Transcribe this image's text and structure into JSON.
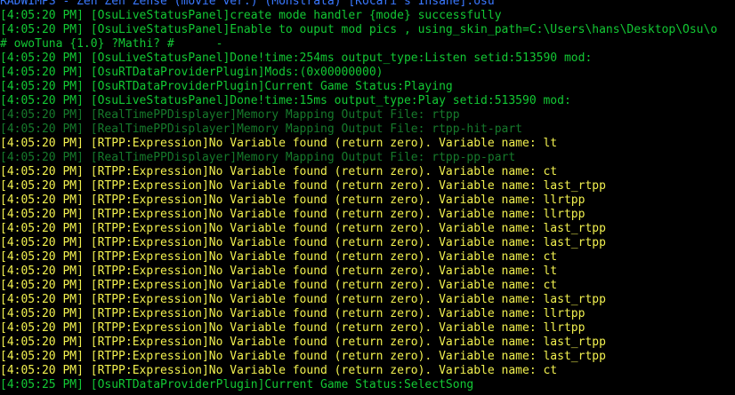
{
  "colors": {
    "background": "#000000",
    "blue": "#3a78ff",
    "green": "#13c934",
    "yellow": "#f2f14f",
    "dim_green": "#167a2b"
  },
  "console": {
    "lines": [
      {
        "color": "blue",
        "time": "",
        "text": "RADWIMPS - Zen Zen Zense (movie ver.) (Monstrata) [Kocari's Insane].osu"
      },
      {
        "color": "green",
        "time": "[4:05:20 PM] ",
        "text": "[OsuLiveStatusPanel]create mode handler {mode} successfully"
      },
      {
        "color": "green",
        "time": "[4:05:20 PM] ",
        "text": "[OsuLiveStatusPanel]Enable to ouput mod pics , using_skin_path=C:\\Users\\hans\\Desktop\\Osu\\o"
      },
      {
        "color": "green",
        "time": "",
        "text": "# owoTuna {1.0} ?Mathi? #      -"
      },
      {
        "color": "green",
        "time": "[4:05:20 PM] ",
        "text": "[OsuLiveStatusPanel]Done!time:254ms output_type:Listen setid:513590 mod:"
      },
      {
        "color": "green",
        "time": "[4:05:20 PM] ",
        "text": "[OsuRTDataProviderPlugin]Mods:(0x00000000)"
      },
      {
        "color": "green",
        "time": "[4:05:20 PM] ",
        "text": "[OsuRTDataProviderPlugin]Current Game Status:Playing"
      },
      {
        "color": "green",
        "time": "[4:05:20 PM] ",
        "text": "[OsuLiveStatusPanel]Done!time:15ms output_type:Play setid:513590 mod:"
      },
      {
        "color": "dim",
        "time": "[4:05:20 PM] ",
        "text": "[RealTimePPDisplayer]Memory Mapping Output File: rtpp"
      },
      {
        "color": "dim",
        "time": "[4:05:20 PM] ",
        "text": "[RealTimePPDisplayer]Memory Mapping Output File: rtpp-hit-part"
      },
      {
        "color": "yellow",
        "time": "[4:05:20 PM] ",
        "text": "[RTPP:Expression]No Variable found (return zero). Variable name: lt"
      },
      {
        "color": "dim",
        "time": "[4:05:20 PM] ",
        "text": "[RealTimePPDisplayer]Memory Mapping Output File: rtpp-pp-part"
      },
      {
        "color": "yellow",
        "time": "[4:05:20 PM] ",
        "text": "[RTPP:Expression]No Variable found (return zero). Variable name: ct"
      },
      {
        "color": "yellow",
        "time": "[4:05:20 PM] ",
        "text": "[RTPP:Expression]No Variable found (return zero). Variable name: last_rtpp"
      },
      {
        "color": "yellow",
        "time": "[4:05:20 PM] ",
        "text": "[RTPP:Expression]No Variable found (return zero). Variable name: llrtpp"
      },
      {
        "color": "yellow",
        "time": "[4:05:20 PM] ",
        "text": "[RTPP:Expression]No Variable found (return zero). Variable name: llrtpp"
      },
      {
        "color": "yellow",
        "time": "[4:05:20 PM] ",
        "text": "[RTPP:Expression]No Variable found (return zero). Variable name: last_rtpp"
      },
      {
        "color": "yellow",
        "time": "[4:05:20 PM] ",
        "text": "[RTPP:Expression]No Variable found (return zero). Variable name: last_rtpp"
      },
      {
        "color": "yellow",
        "time": "[4:05:20 PM] ",
        "text": "[RTPP:Expression]No Variable found (return zero). Variable name: ct"
      },
      {
        "color": "yellow",
        "time": "[4:05:20 PM] ",
        "text": "[RTPP:Expression]No Variable found (return zero). Variable name: lt"
      },
      {
        "color": "yellow",
        "time": "[4:05:20 PM] ",
        "text": "[RTPP:Expression]No Variable found (return zero). Variable name: ct"
      },
      {
        "color": "yellow",
        "time": "[4:05:20 PM] ",
        "text": "[RTPP:Expression]No Variable found (return zero). Variable name: last_rtpp"
      },
      {
        "color": "yellow",
        "time": "[4:05:20 PM] ",
        "text": "[RTPP:Expression]No Variable found (return zero). Variable name: llrtpp"
      },
      {
        "color": "yellow",
        "time": "[4:05:20 PM] ",
        "text": "[RTPP:Expression]No Variable found (return zero). Variable name: llrtpp"
      },
      {
        "color": "yellow",
        "time": "[4:05:20 PM] ",
        "text": "[RTPP:Expression]No Variable found (return zero). Variable name: last_rtpp"
      },
      {
        "color": "yellow",
        "time": "[4:05:20 PM] ",
        "text": "[RTPP:Expression]No Variable found (return zero). Variable name: last_rtpp"
      },
      {
        "color": "yellow",
        "time": "[4:05:20 PM] ",
        "text": "[RTPP:Expression]No Variable found (return zero). Variable name: ct"
      },
      {
        "color": "green",
        "time": "[4:05:25 PM] ",
        "text": "[OsuRTDataProviderPlugin]Current Game Status:SelectSong"
      }
    ]
  }
}
